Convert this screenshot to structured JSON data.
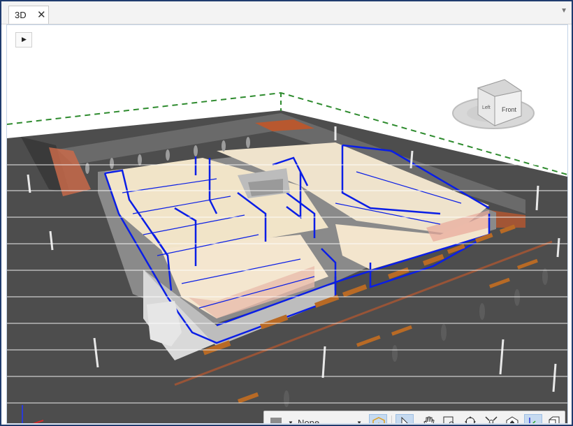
{
  "tab": {
    "label": "3D",
    "close_glyph": "✕"
  },
  "viewcube": {
    "face_front": "Front",
    "face_left": "Left"
  },
  "toolbar": {
    "display_filter_value": "None",
    "icons": [
      "display-style-icon",
      "filter-cube-icon",
      "select-icon",
      "pan-icon",
      "zoom-window-icon",
      "orbit-icon",
      "zoom-extents-icon",
      "home-view-icon",
      "axis-toggle-icon",
      "box-view-icon"
    ]
  },
  "colors": {
    "frame": "#1f3b6e",
    "wall_outline": "#0a1ee6",
    "ground": "#4a4a4a",
    "floor": "#f1e4c8",
    "boundary": "#2e8b2e",
    "toolbar_active": "#c6daf0"
  }
}
